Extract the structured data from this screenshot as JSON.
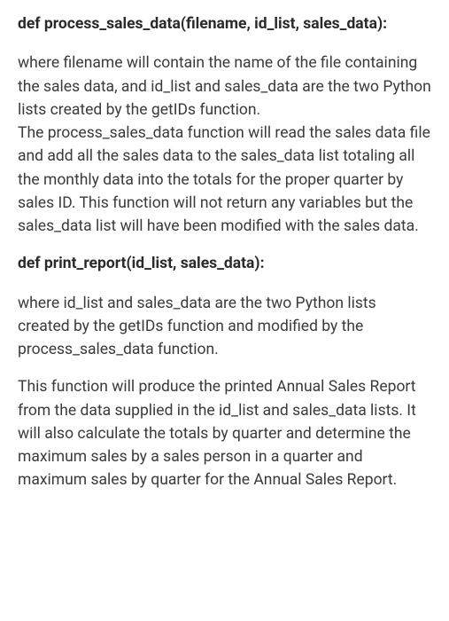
{
  "sections": {
    "func1_signature": "def process_sales_data(filename, id_list, sales_data):",
    "func1_para1": "where filename will contain the name of the file containing the sales data, and id_list and sales_data are the two Python lists created by the getIDs function.",
    "func1_para2": "The process_sales_data function will read the sales data file and add all the sales data to the sales_data list totaling all the monthly data into the totals for the proper quarter by sales ID. This function will not return any variables but the sales_data list will have been modified with the sales data.",
    "func2_signature": "def print_report(id_list, sales_data):",
    "func2_para1": "where id_list and sales_data are the two Python lists created by the getIDs function and modified by the process_sales_data function.",
    "func2_para2": "This function will produce the printed Annual Sales Report from the data supplied in the id_list and sales_data lists. It will also calculate the totals by quarter and determine the maximum sales by a sales person in a quarter and maximum sales by quarter for the Annual Sales Report."
  }
}
